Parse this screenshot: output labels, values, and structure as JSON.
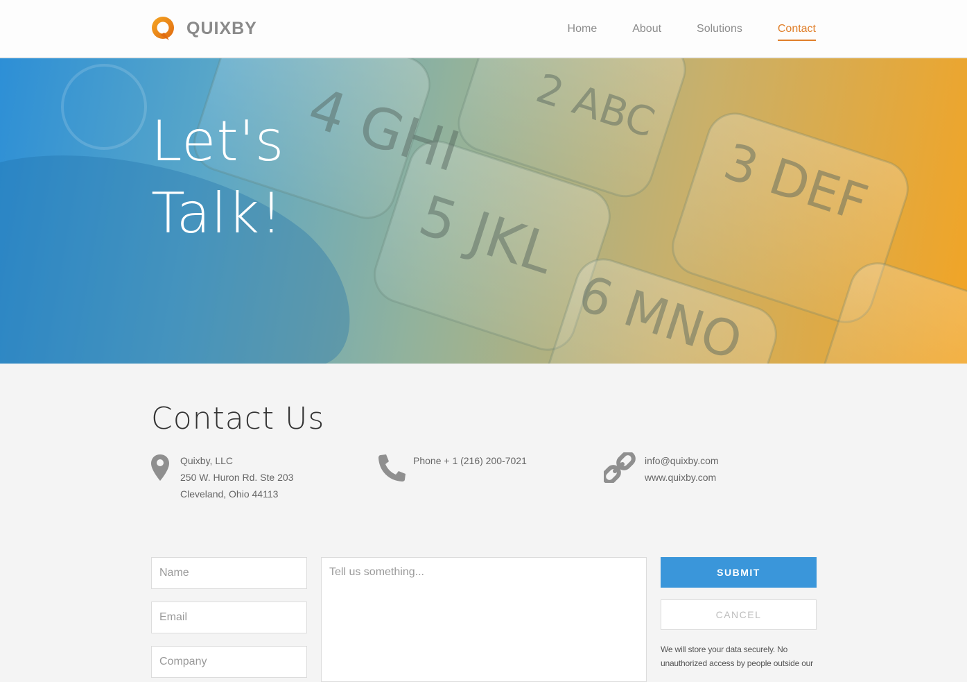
{
  "brand": {
    "name": "QUIXBY",
    "accent": "#e07f2a",
    "logo_icon": "q-logo-icon"
  },
  "nav": {
    "items": [
      {
        "label": "Home",
        "active": false
      },
      {
        "label": "About",
        "active": false
      },
      {
        "label": "Solutions",
        "active": false
      },
      {
        "label": "Contact",
        "active": true
      }
    ]
  },
  "hero": {
    "title_line1": "Let's",
    "title_line2": "Talk!",
    "background": "keypad-photo",
    "keys": [
      "4 GHI",
      "2 ABC",
      "5 JKL",
      "3 DEF",
      "6 MNO"
    ]
  },
  "contact": {
    "title": "Contact Us",
    "address": {
      "icon": "map-pin-icon",
      "lines": [
        "Quixby, LLC",
        "250 W. Huron Rd. Ste 203",
        "Cleveland, Ohio 44113"
      ]
    },
    "phone": {
      "icon": "phone-icon",
      "lines": [
        "Phone + 1 (216) 200-7021"
      ]
    },
    "web": {
      "icon": "link-icon",
      "lines": [
        "info@quixby.com",
        "www.quixby.com"
      ]
    }
  },
  "form": {
    "name_placeholder": "Name",
    "email_placeholder": "Email",
    "company_placeholder": "Company",
    "message_placeholder": "Tell us something...",
    "submit_label": "SUBMIT",
    "cancel_label": "CANCEL",
    "privacy_text": "We will store your data securely. No unauthorized access by people outside our",
    "submit_color": "#3a96da"
  }
}
